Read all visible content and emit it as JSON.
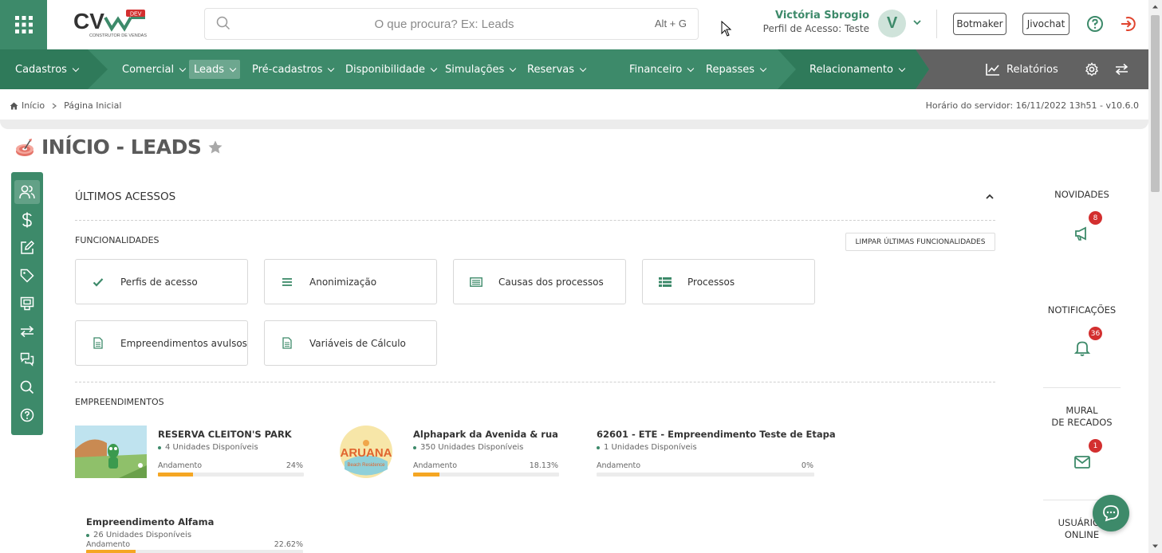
{
  "header": {
    "search_placeholder": "O que procura? Ex: Leads",
    "search_shortcut": "Alt + G",
    "user_name": "Victória Sbrogio",
    "user_profile": "Perfil de Acesso: Teste",
    "avatar_letter": "V",
    "botmaker_label": "Botmaker",
    "jivochat_label": "Jivochat",
    "logo_text": "CV",
    "logo_sub": "CONSTRUTOR DE VENDAS",
    "logo_badge": "DEV"
  },
  "nav": {
    "cadastros": "Cadastros",
    "comercial": "Comercial",
    "leads": "Leads",
    "pre_cadastros": "Pré-cadastros",
    "disponibilidade": "Disponibilidade",
    "simulacoes": "Simulações",
    "reservas": "Reservas",
    "financeiro": "Financeiro",
    "repasses": "Repasses",
    "relacionamento": "Relacionamento",
    "relatorios": "Relatórios"
  },
  "breadcrumb": {
    "home": "Início",
    "current": "Página Inicial",
    "server_time": "Horário do servidor: 16/11/2022 13h51 - v10.6.0"
  },
  "page": {
    "title": "INÍCIO - LEADS"
  },
  "main": {
    "ultimos_acessos": "ÚLTIMOS ACESSOS",
    "funcionalidades": "FUNCIONALIDADES",
    "clear_label": "LIMPAR ÚLTIMAS FUNCIONALIDADES",
    "cards": [
      {
        "label": "Perfis de acesso",
        "icon": "check-icon"
      },
      {
        "label": "Anonimização",
        "icon": "list-icon"
      },
      {
        "label": "Causas dos processos",
        "icon": "table-icon"
      },
      {
        "label": "Processos",
        "icon": "list-grid-icon"
      },
      {
        "label": "Empreendimentos avulsos",
        "icon": "document-icon"
      },
      {
        "label": "Variáveis de Cálculo",
        "icon": "document-icon"
      }
    ],
    "empreendimentos": "EMPREENDIMENTOS",
    "projects": [
      {
        "name": "RESERVA CLEITON'S PARK",
        "units": "4 Unidades Disponíveis",
        "progress_label": "Andamento",
        "progress": "24%",
        "progress_value": 24
      },
      {
        "name": "Alphapark da Avenida & rua",
        "units": "350 Unidades Disponíveis",
        "progress_label": "Andamento",
        "progress": "18.13%",
        "progress_value": 18.13,
        "logo_text": "ARUANA",
        "logo_sub": "Beach Residence"
      },
      {
        "name": "62601 - ETE - Empreendimento Teste de Etapa",
        "units": "1 Unidades Disponíveis",
        "progress_label": "Andamento",
        "progress": "0%",
        "progress_value": 0
      },
      {
        "name": "Empreendimento Alfama",
        "units": "26 Unidades Disponíveis",
        "progress_label": "Andamento",
        "progress": "22.62%",
        "progress_value": 22.62
      }
    ]
  },
  "widgets": {
    "novidades": "NOVIDADES",
    "novidades_count": "8",
    "notificacoes": "NOTIFICAÇÕES",
    "notificacoes_count": "36",
    "mural_line1": "MURAL",
    "mural_line2": "DE RECADOS",
    "mural_count": "1",
    "usuarios_line1": "USUÁRIOS",
    "usuarios_line2": "ONLINE"
  },
  "colors": {
    "primary": "#3d8a6a",
    "nav_dark": "#5f5f5f",
    "progress": "#f5a623",
    "badge": "#d32f2f"
  }
}
